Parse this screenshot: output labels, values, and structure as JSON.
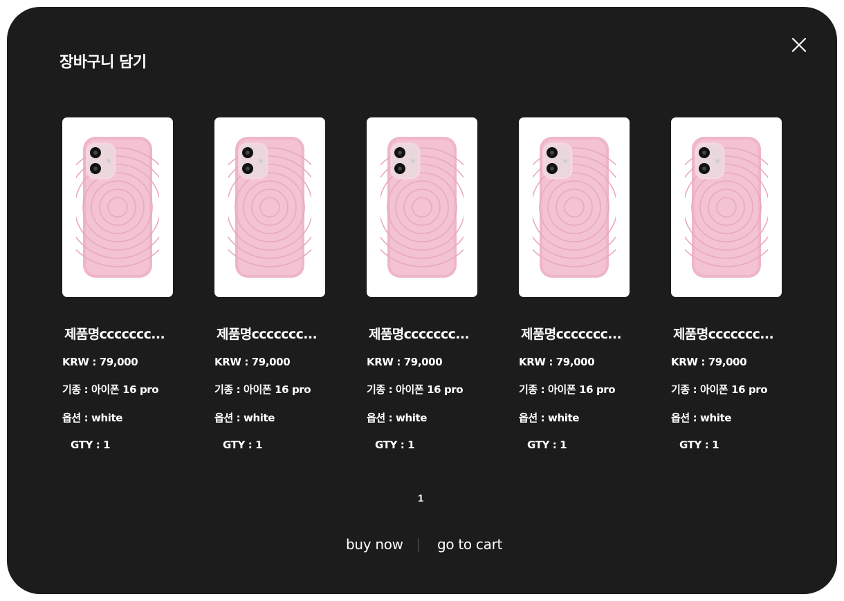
{
  "modal": {
    "title": "장바구니 담기",
    "close_icon": "close-icon"
  },
  "products": [
    {
      "name": "제품명ccccccc...",
      "price": "KRW : 79,000",
      "model": "기종 : 아이폰 16 pro",
      "option": "옵션 : white",
      "qty": "GTY : 1",
      "image": "pink-phone-case"
    },
    {
      "name": "제품명ccccccc...",
      "price": "KRW : 79,000",
      "model": "기종 : 아이폰 16 pro",
      "option": "옵션 : white",
      "qty": "GTY : 1",
      "image": "pink-phone-case"
    },
    {
      "name": "제품명ccccccc...",
      "price": "KRW : 79,000",
      "model": "기종 : 아이폰 16 pro",
      "option": "옵션 : white",
      "qty": "GTY : 1",
      "image": "pink-phone-case"
    },
    {
      "name": "제품명ccccccc...",
      "price": "KRW : 79,000",
      "model": "기종 : 아이폰 16 pro",
      "option": "옵션 : white",
      "qty": "GTY : 1",
      "image": "pink-phone-case"
    },
    {
      "name": "제품명ccccccc...",
      "price": "KRW : 79,000",
      "model": "기종 : 아이폰 16 pro",
      "option": "옵션 : white",
      "qty": "GTY : 1",
      "image": "pink-phone-case"
    }
  ],
  "pagination": {
    "current_page": "1"
  },
  "actions": {
    "buy_now": "buy now",
    "go_to_cart": "go to cart"
  },
  "colors": {
    "modal_background": "#1c1c1c",
    "text": "#ffffff",
    "case_pink": "#f0b8cc"
  }
}
